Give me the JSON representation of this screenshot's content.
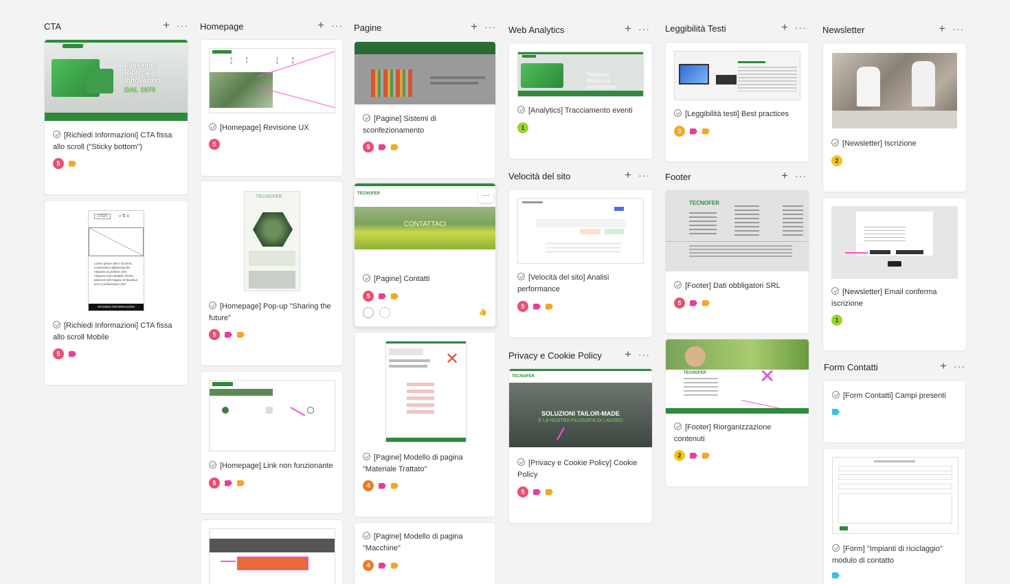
{
  "colors": {
    "badge_red": "#ec4d73",
    "badge_orange": "#f07a2a",
    "badge_yellow": "#f4c21a",
    "badge_lime": "#9bd22e",
    "tag_pink": "#e83e98",
    "tag_orange": "#f5a623",
    "tag_blue": "#3cc0e6",
    "brand_green": "#2f8a3b"
  },
  "columns": [
    {
      "title": "CTA"
    },
    {
      "title": "Homepage"
    },
    {
      "title": "Pagine"
    },
    {
      "title": "Web Analytics"
    },
    {
      "title": "Velocità del sito"
    },
    {
      "title": "Privacy e Cookie Policy"
    },
    {
      "title": "Leggibilità Testi"
    },
    {
      "title": "Footer"
    },
    {
      "title": "Newsletter"
    },
    {
      "title": "Form Contatti"
    }
  ],
  "cards": {
    "cta_sticky": {
      "title": "[Richiedi Informazioni] CTA fissa allo scroll (\"Sticky bottom\")",
      "count": "5",
      "hero": "Passione, Ricerca e Innovazione",
      "year": "DAL 1976"
    },
    "cta_mobile": {
      "title": "[Richiedi Informazioni] CTA fissa allo scroll Mobile",
      "count": "5",
      "logo": "LOGO",
      "lorem": "Lorem ipsum dolor sit amet, consectetur adipiscing elit. Aliquam at porttitor sem. Aliquam erat volutpat. Donec placerat nisl magna, et faucibus arcu condimentum sed.",
      "cta": "RICHIEDI INFORMAZIONI"
    },
    "home_ux": {
      "title": "[Homepage] Revisione UX",
      "count": "5"
    },
    "home_popup": {
      "title": "[Homepage] Pop-up \"Sharing the future\"",
      "count": "5"
    },
    "home_link": {
      "title": "[Homepage] Link non funzionante",
      "count": "5"
    },
    "pag_sistemi": {
      "title": "[Pagine] Sistemi di sconfezionamento",
      "count": "5"
    },
    "pag_contatti": {
      "title": "[Pagine] Contatti",
      "count": "5",
      "hero": "CONTATTACI"
    },
    "pag_materiale": {
      "title": "[Pagine] Modello di pagina \"Materiale Trattato\"",
      "count": "4"
    },
    "pag_macchine": {
      "title": "[Pagine] Modello di pagina \"Macchine\"",
      "count": "4"
    },
    "wa_eventi": {
      "title": "[Analytics] Tracciamento eventi",
      "count": "1"
    },
    "vel_analisi": {
      "title": "[Velocità del sito] Analisi performance",
      "count": "5"
    },
    "priv_cookie": {
      "title": "[Privacy e Cookie Policy] Cookie Policy",
      "count": "5",
      "hero": "SOLUZIONI TAILOR-MADE",
      "hero2": "E LA NOSTRA FILOSOFIA DI LAVORO"
    },
    "legg_best": {
      "title": "[Leggibilità testi] Best practices",
      "count": "3"
    },
    "foot_dati": {
      "title": "[Footer] Dati obbligatori SRL",
      "count": "5"
    },
    "foot_riorg": {
      "title": "[Footer] Riorganizzazione contenuti",
      "count": "2"
    },
    "news_iscr": {
      "title": "[Newsletter] Iscrizione",
      "count": "2"
    },
    "news_email": {
      "title": "[Newsletter] Email conferma iscrizione",
      "count": "1"
    },
    "form_campi": {
      "title": "[Form Contatti] Campi presenti"
    },
    "form_impianti": {
      "title": "[Form] \"Impianti di riciclaggio\" modulo di contatto"
    }
  },
  "brand": "TECNOFER"
}
